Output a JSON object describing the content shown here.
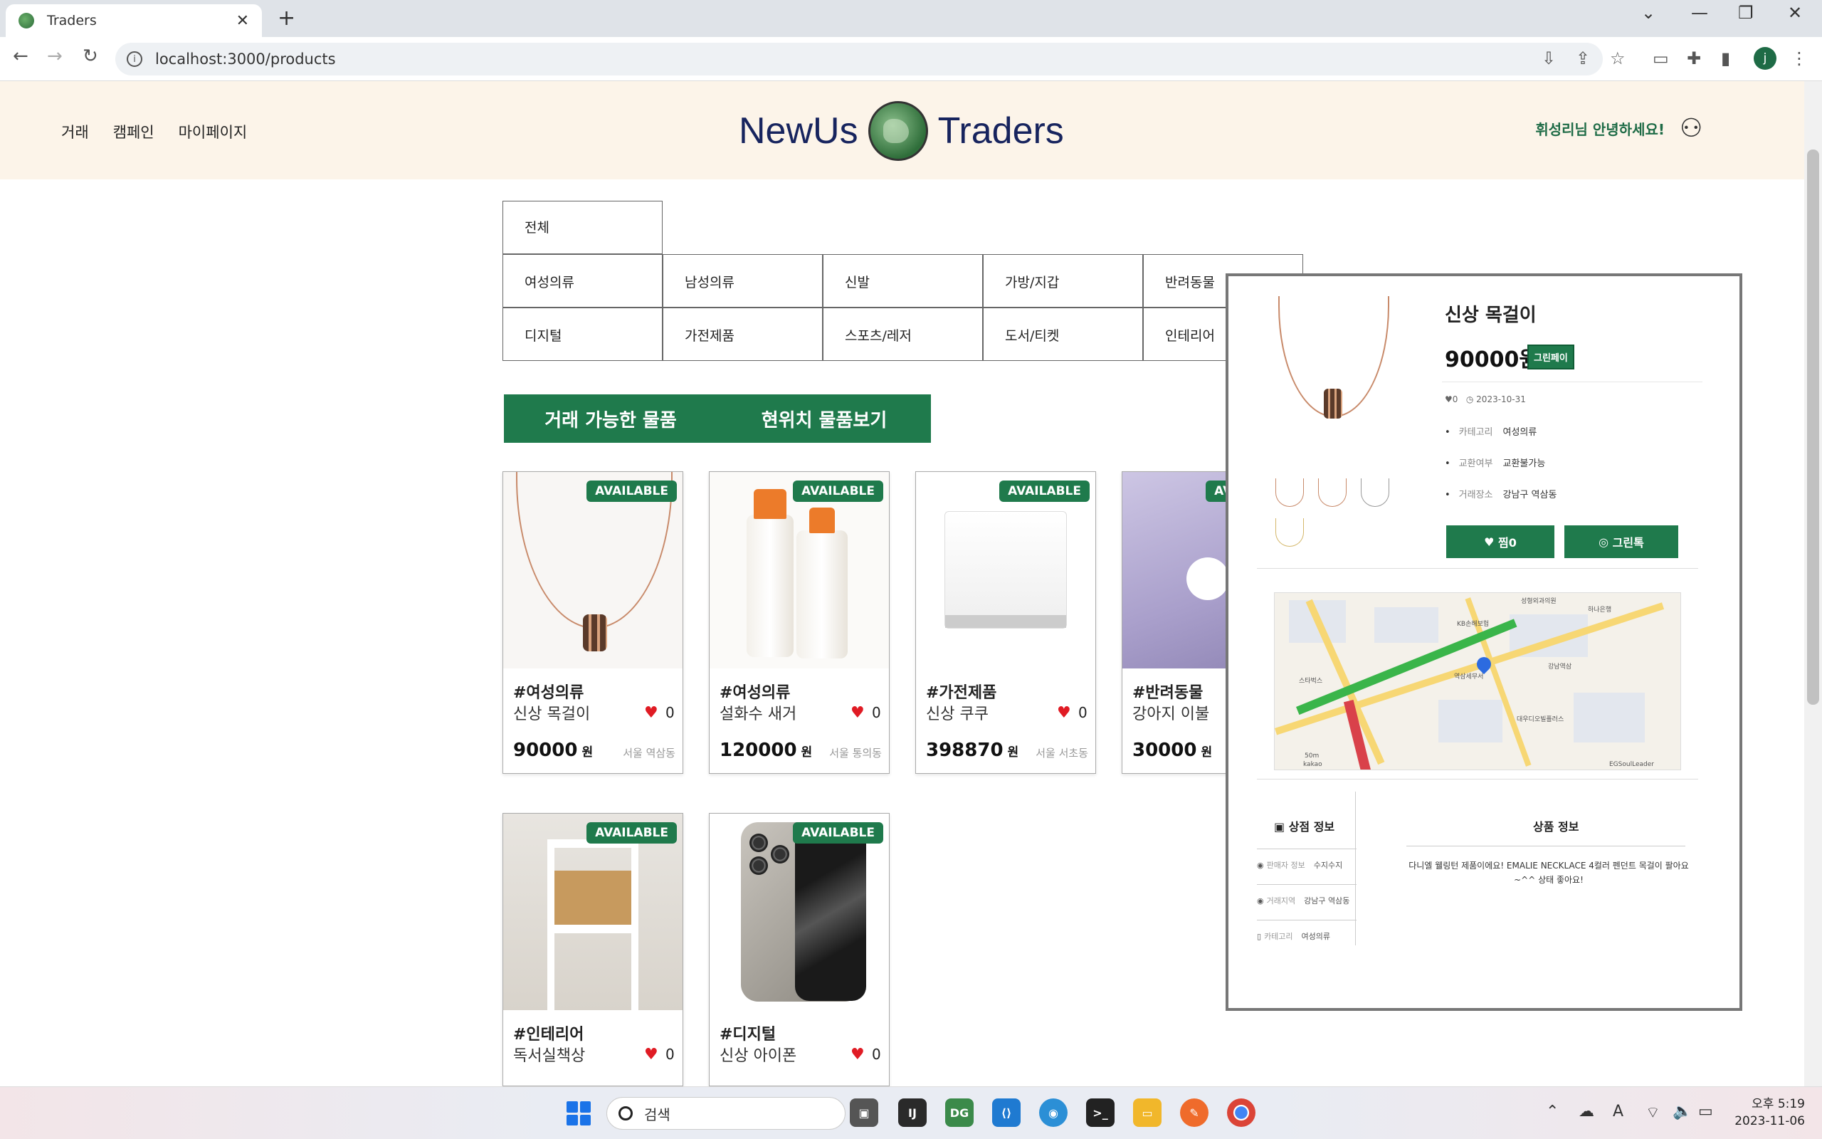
{
  "browser": {
    "tab_title": "Traders",
    "url": "localhost:3000/products",
    "profile_initial": "j"
  },
  "site": {
    "nav": [
      "거래",
      "캠페인",
      "마이페이지"
    ],
    "logo_left": "NewUs",
    "logo_right": "Traders",
    "greeting": "휘성리님 안녕하세요!"
  },
  "categories": {
    "all": "전체",
    "row1": [
      "여성의류",
      "남성의류",
      "신발",
      "가방/지갑",
      "반려동물"
    ],
    "row2": [
      "디지털",
      "가전제품",
      "스포츠/레저",
      "도서/티켓",
      "인테리어"
    ]
  },
  "toggle": {
    "available": "거래 가능한 물품",
    "nearby": "현위치 물품보기"
  },
  "badge": "AVAILABLE",
  "currency": "원",
  "products": [
    {
      "category": "#여성의류",
      "name": "신상 목걸이",
      "likes": "0",
      "price": "90000",
      "location": "서울 역삼동"
    },
    {
      "category": "#여성의류",
      "name": "설화수 새거",
      "likes": "0",
      "price": "120000",
      "location": "서울 통의동"
    },
    {
      "category": "#가전제품",
      "name": "신상 쿠쿠",
      "likes": "0",
      "price": "398870",
      "location": "서울 서초동"
    },
    {
      "category": "#반려동물",
      "name": "강아지 이불",
      "likes": "0",
      "price": "30000",
      "location": ""
    },
    {
      "category": "#인테리어",
      "name": "독서실책상",
      "likes": "0",
      "price": "",
      "location": ""
    },
    {
      "category": "#디지털",
      "name": "신상 아이폰",
      "likes": "0",
      "price": "",
      "location": ""
    }
  ],
  "detail": {
    "title": "신상 목걸이",
    "price": "90000원",
    "greenpay": "그린페이",
    "likes": "0",
    "date": "2023-10-31",
    "rows": [
      {
        "label": "카테고리",
        "value": "여성의류"
      },
      {
        "label": "교환여부",
        "value": "교환불가능"
      },
      {
        "label": "거래장소",
        "value": "강남구 역삼동"
      }
    ],
    "jjim_button": "찜0",
    "talk_button": "그린톡",
    "map_labels": [
      "성형외과의원",
      "하나은행",
      "KB손해보험",
      "강남역삼",
      "역삼세무서",
      "스타벅스",
      "대우디오빌플러스",
      "EGSoulLeader",
      "kakao",
      "50m"
    ],
    "shop_info_title": "상점 정보",
    "shop_rows": [
      {
        "label": "판매자 정보",
        "value": "수지수지"
      },
      {
        "label": "거래지역",
        "value": "강남구 역삼동"
      },
      {
        "label": "카테고리",
        "value": "여성의류"
      }
    ],
    "product_info_title": "상품 정보",
    "product_desc": "다니엘 웰링턴 제품이에요! EMALIE NECKLACE 4컬러 펜던트 목걸이 팔아요 ~^^ 상태 좋아요!"
  },
  "taskbar": {
    "search": "검색",
    "time": "오후 5:19",
    "date": "2023-11-06"
  }
}
